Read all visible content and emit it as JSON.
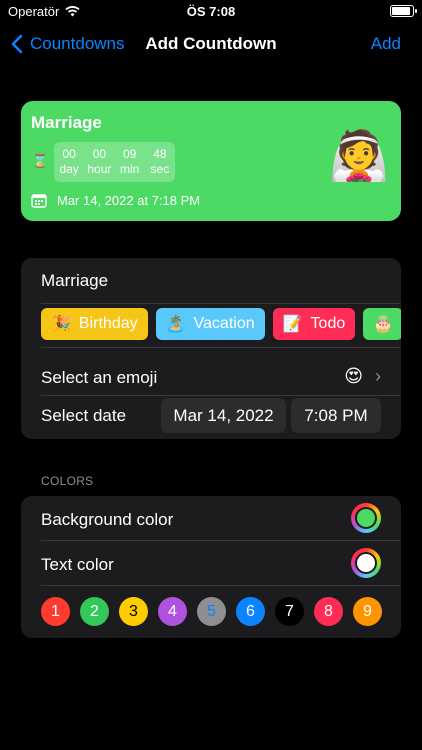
{
  "status_bar": {
    "carrier": "Operatör",
    "time": "ÖS 7:08"
  },
  "nav": {
    "back_label": "Countdowns",
    "title": "Add Countdown",
    "add_label": "Add"
  },
  "preview": {
    "title": "Marriage",
    "countdown": [
      {
        "value": "00",
        "unit": "day"
      },
      {
        "value": "00",
        "unit": "hour"
      },
      {
        "value": "09",
        "unit": "min"
      },
      {
        "value": "48",
        "unit": "sec"
      }
    ],
    "date_text": "Mar 14, 2022 at 7:18 PM",
    "emoji": "👰",
    "background_color": "#4cd964"
  },
  "form": {
    "name_value": "Marriage",
    "chips": [
      {
        "emoji": "🎉",
        "label": "Birthday",
        "color": "#f5c518"
      },
      {
        "emoji": "🏝️",
        "label": "Vacation",
        "color": "#5ac8fa"
      },
      {
        "emoji": "📝",
        "label": "Todo",
        "color": "#ff2d55"
      },
      {
        "emoji": "🎂",
        "label": "",
        "color": "#4cd964"
      }
    ],
    "emoji_label": "Select an emoji",
    "emoji_value": "😍",
    "date_label": "Select date",
    "date_value": "Mar 14, 2022",
    "time_value": "7:08 PM"
  },
  "colors": {
    "header": "COLORS",
    "background_label": "Background color",
    "background_value": "#4cd964",
    "text_label": "Text color",
    "text_value": "#ffffff",
    "palette": [
      {
        "label": "1",
        "color": "#ff3b30",
        "text": "#ffffff"
      },
      {
        "label": "2",
        "color": "#34c759",
        "text": "#ffffff"
      },
      {
        "label": "3",
        "color": "#ffcc00",
        "text": "#000000"
      },
      {
        "label": "4",
        "color": "#af52de",
        "text": "#ffffff"
      },
      {
        "label": "5",
        "color": "#8e8e93",
        "text": "#0a84ff"
      },
      {
        "label": "6",
        "color": "#0a84ff",
        "text": "#ffffff"
      },
      {
        "label": "7",
        "color": "#000000",
        "text": "#ffffff"
      },
      {
        "label": "8",
        "color": "#ff2d55",
        "text": "#ffffff"
      },
      {
        "label": "9",
        "color": "#ff9500",
        "text": "#ffffff"
      }
    ]
  }
}
